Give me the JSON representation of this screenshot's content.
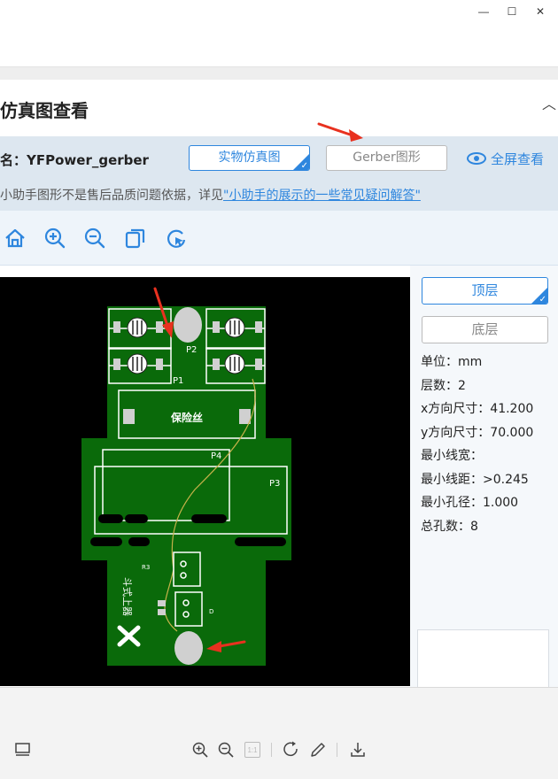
{
  "window": {
    "minimize_glyph": "—",
    "maximize_glyph": "☐",
    "close_glyph": "✕"
  },
  "panel": {
    "title": "仿真图查看",
    "collapse_glyph": "︿"
  },
  "info": {
    "file_name": "名：YFPower_gerber",
    "button_real": "实物仿真图",
    "button_gerber": "Gerber图形",
    "fullscreen": "全屏查看",
    "notice_prefix": "小助手图形不是售后品质问题依据，详见",
    "notice_link": "\"小助手的展示的一些常见疑问解答\""
  },
  "toolbar": {
    "icons": [
      "home-icon",
      "zoom-in-icon",
      "zoom-out-icon",
      "copy-icon",
      "rotate-icon"
    ]
  },
  "pcb": {
    "labels": {
      "p1": "P1",
      "p2": "P2",
      "p3": "P3",
      "p4": "P4",
      "fuse": "保险丝",
      "logo_text": "斗式上器",
      "small_text_1": "R3",
      "small_text_2": "D"
    },
    "colors": {
      "board": "#0a6a0a",
      "silkscreen": "#ffffff",
      "pad": "#d0d0d0",
      "background": "#000000",
      "annotation_arrow": "#e8311f"
    }
  },
  "layers": {
    "top": "顶层",
    "bottom": "底层"
  },
  "specs": [
    {
      "label": "单位：",
      "value": "mm"
    },
    {
      "label": "层数：",
      "value": "2"
    },
    {
      "label": "x方向尺寸：",
      "value": "41.200"
    },
    {
      "label": "y方向尺寸：",
      "value": "70.000"
    },
    {
      "label": "最小线宽：",
      "value": ""
    },
    {
      "label": "最小线距：",
      "value": ">0.245"
    },
    {
      "label": "最小孔径：",
      "value": "1.000"
    },
    {
      "label": "总孔数：",
      "value": "8"
    }
  ],
  "bottom_bar": {
    "icons": [
      "layout-icon",
      "zoom-in-icon",
      "zoom-out-icon",
      "actual-size-icon",
      "rotate-icon",
      "edit-icon",
      "download-icon"
    ],
    "actual_size_label": "1:1"
  }
}
